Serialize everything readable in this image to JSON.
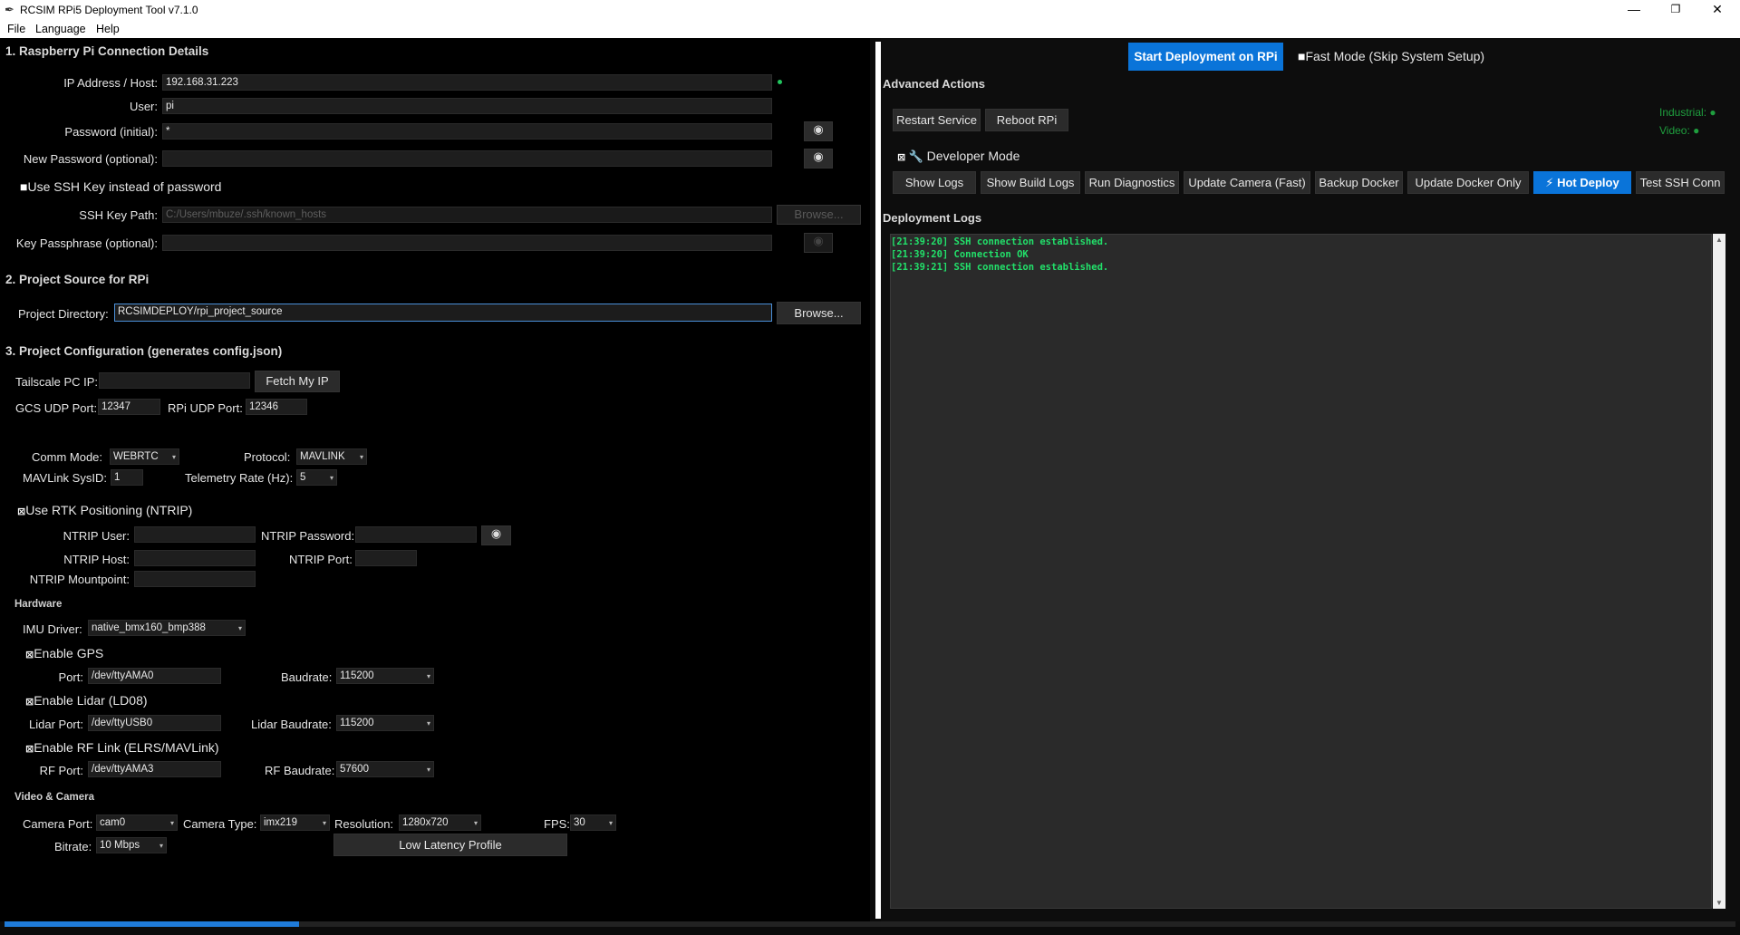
{
  "window": {
    "title": "RCSIM RPi5 Deployment Tool v7.1.0",
    "minimize": "—",
    "maximize": "❐",
    "close": "✕"
  },
  "menu": {
    "file": "File",
    "language": "Language",
    "help": "Help"
  },
  "connection": {
    "section": "1. Raspberry Pi Connection Details",
    "ip_label": "IP Address / Host:",
    "ip_value": "192.168.31.223",
    "user_label": "User:",
    "user_value": "pi",
    "password_label": "Password (initial):",
    "password_value": "*",
    "new_password_label": "New Password (optional):",
    "new_password_value": "",
    "use_ssh_key_label": "Use SSH Key instead of password",
    "use_ssh_key_checked": false,
    "ssh_key_path_label": "SSH Key Path:",
    "ssh_key_path_value": "C:/Users/mbuze/.ssh/known_hosts",
    "browse_label": "Browse...",
    "key_passphrase_label": "Key Passphrase (optional):",
    "key_passphrase_value": ""
  },
  "project_source": {
    "section": "2. Project Source for RPi",
    "dir_label": "Project Directory:",
    "dir_value": "RCSIMDEPLOY/rpi_project_source",
    "browse_label": "Browse..."
  },
  "config": {
    "section": "3. Project Configuration (generates config.json)",
    "tailscale_label": "Tailscale PC IP:",
    "tailscale_value": "",
    "fetch_ip_label": "Fetch My IP",
    "gcs_udp_label": "GCS UDP Port:",
    "gcs_udp_value": "12347",
    "rpi_udp_label": "RPi UDP Port:",
    "rpi_udp_value": "12346",
    "comm_mode_label": "Comm Mode:",
    "comm_mode_value": "WEBRTC",
    "protocol_label": "Protocol:",
    "protocol_value": "MAVLINK",
    "sysid_label": "MAVLink SysID:",
    "sysid_value": "1",
    "telemetry_label": "Telemetry Rate (Hz):",
    "telemetry_value": "5",
    "rtk_label": "Use RTK Positioning (NTRIP)",
    "rtk_checked": true,
    "ntrip_user_label": "NTRIP User:",
    "ntrip_user_value": "",
    "ntrip_password_label": "NTRIP Password:",
    "ntrip_password_value": "",
    "ntrip_host_label": "NTRIP Host:",
    "ntrip_host_value": "",
    "ntrip_port_label": "NTRIP Port:",
    "ntrip_port_value": "",
    "ntrip_mount_label": "NTRIP Mountpoint:",
    "ntrip_mount_value": ""
  },
  "hardware": {
    "section": "Hardware",
    "imu_label": "IMU Driver:",
    "imu_value": "native_bmx160_bmp388",
    "gps_label": "Enable GPS",
    "gps_checked": true,
    "gps_port_label": "Port:",
    "gps_port_value": "/dev/ttyAMA0",
    "gps_baud_label": "Baudrate:",
    "gps_baud_value": "115200",
    "lidar_label": "Enable Lidar (LD08)",
    "lidar_checked": true,
    "lidar_port_label": "Lidar Port:",
    "lidar_port_value": "/dev/ttyUSB0",
    "lidar_baud_label": "Lidar Baudrate:",
    "lidar_baud_value": "115200",
    "rf_label": "Enable RF Link (ELRS/MAVLink)",
    "rf_checked": true,
    "rf_port_label": "RF Port:",
    "rf_port_value": "/dev/ttyAMA3",
    "rf_baud_label": "RF Baudrate:",
    "rf_baud_value": "57600"
  },
  "video": {
    "section": "Video & Camera",
    "camera_port_label": "Camera Port:",
    "camera_port_value": "cam0",
    "camera_type_label": "Camera Type:",
    "camera_type_value": "imx219",
    "resolution_label": "Resolution:",
    "resolution_value": "1280x720",
    "fps_label": "FPS:",
    "fps_value": "30",
    "bitrate_label": "Bitrate:",
    "bitrate_value": "10 Mbps",
    "low_latency_label": "Low Latency Profile"
  },
  "right": {
    "start_deploy_label": "Start Deployment on RPi",
    "fast_mode_label": "Fast Mode (Skip System Setup)",
    "fast_mode_checked": false,
    "advanced_section": "Advanced Actions",
    "restart_service_label": "Restart Service",
    "reboot_label": "Reboot RPi",
    "industrial_label": "Industrial:",
    "video_status_label": "Video:",
    "developer_mode_label": "Developer Mode",
    "developer_mode_checked": true,
    "actions": [
      "Show Logs",
      "Show Build Logs",
      "Run Diagnostics",
      "Update Camera (Fast)",
      "Backup Docker",
      "Update Docker Only",
      "Hot Deploy",
      "Test SSH Conn"
    ],
    "logs_section": "Deployment Logs",
    "logs": [
      "[21:39:20] SSH connection established.",
      "[21:39:20] Connection OK",
      "[21:39:21] SSH connection established."
    ]
  },
  "progress": {
    "fraction": 0.17
  },
  "colors": {
    "accent": "#0a74d9",
    "status_green": "#22c55e",
    "log_text": "#22e06a"
  }
}
